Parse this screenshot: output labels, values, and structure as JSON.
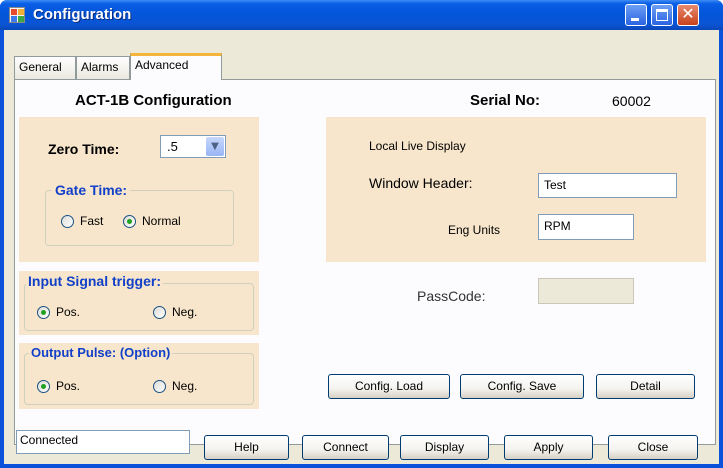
{
  "window": {
    "title": "Configuration",
    "minimize_label": "_",
    "maximize_label": "",
    "close_label": "✕"
  },
  "tabs": [
    {
      "label": "General"
    },
    {
      "label": "Alarms"
    },
    {
      "label": "Advanced",
      "selected": true
    }
  ],
  "advanced": {
    "heading": "ACT-1B Configuration",
    "serial_label": "Serial No:",
    "serial_value": "60002",
    "zero_time_label": "Zero Time:",
    "zero_time_value": ".5",
    "gate_time": {
      "legend": "Gate Time:",
      "options": [
        {
          "label": "Fast",
          "checked": false
        },
        {
          "label": "Normal",
          "checked": true
        }
      ]
    },
    "input_signal": {
      "legend": "Input Signal trigger:",
      "options": [
        {
          "label": "Pos.",
          "checked": true
        },
        {
          "label": "Neg.",
          "checked": false
        }
      ]
    },
    "output_pulse": {
      "legend": "Output Pulse: (Option)",
      "options": [
        {
          "label": "Pos.",
          "checked": true
        },
        {
          "label": "Neg.",
          "checked": false
        }
      ]
    },
    "local_display": {
      "title": "Local Live Display",
      "window_header_label": "Window Header:",
      "window_header_value": "Test",
      "eng_units_label": "Eng Units",
      "eng_units_value": "RPM"
    },
    "passcode_label": "PassCode:",
    "passcode_value": "",
    "buttons": {
      "config_load": "Config. Load",
      "config_save": "Config. Save",
      "detail": "Detail"
    }
  },
  "footer": {
    "status": "Connected",
    "help": "Help",
    "connect": "Connect",
    "display": "Display",
    "apply": "Apply",
    "close": "Close"
  },
  "colors": {
    "titlebar": "#0455da",
    "panel": "#f7e6cb",
    "legend": "#1240c8",
    "selected_tab_accent": "#f5b53b"
  }
}
